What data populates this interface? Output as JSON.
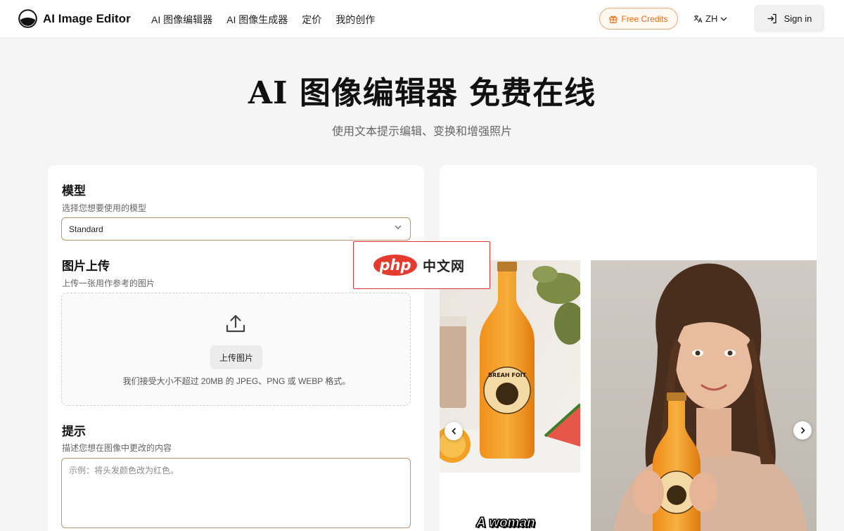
{
  "header": {
    "logo_text": "AI Image Editor",
    "nav": [
      "AI 图像编辑器",
      "AI 图像生成器",
      "定价",
      "我的创作"
    ],
    "credits_label": "Free Credits",
    "lang_label": "ZH",
    "signin_label": "Sign in"
  },
  "hero": {
    "title": "AI 图像编辑器 免费在线",
    "subtitle": "使用文本提示编辑、变换和增强照片"
  },
  "form": {
    "model": {
      "title": "模型",
      "desc": "选择您想要使用的模型",
      "selected": "Standard"
    },
    "upload": {
      "title": "图片上传",
      "desc": "上传一张用作参考的图片",
      "button_label": "上传图片",
      "note": "我们接受大小不超过 20MB 的 JPEG、PNG 或 WEBP 格式。"
    },
    "prompt": {
      "title": "提示",
      "desc": "描述您想在图像中更改的内容",
      "placeholder": "示例：将头发颜色改为红色。",
      "value": ""
    }
  },
  "preview": {
    "caption": "A woman",
    "bottle_label": "BREAH FOIT"
  },
  "watermark": {
    "badge": "php",
    "text": "中文网"
  },
  "colors": {
    "accent": "#e46a14",
    "field_border": "#c2926d",
    "watermark_red": "#e53b2e"
  }
}
